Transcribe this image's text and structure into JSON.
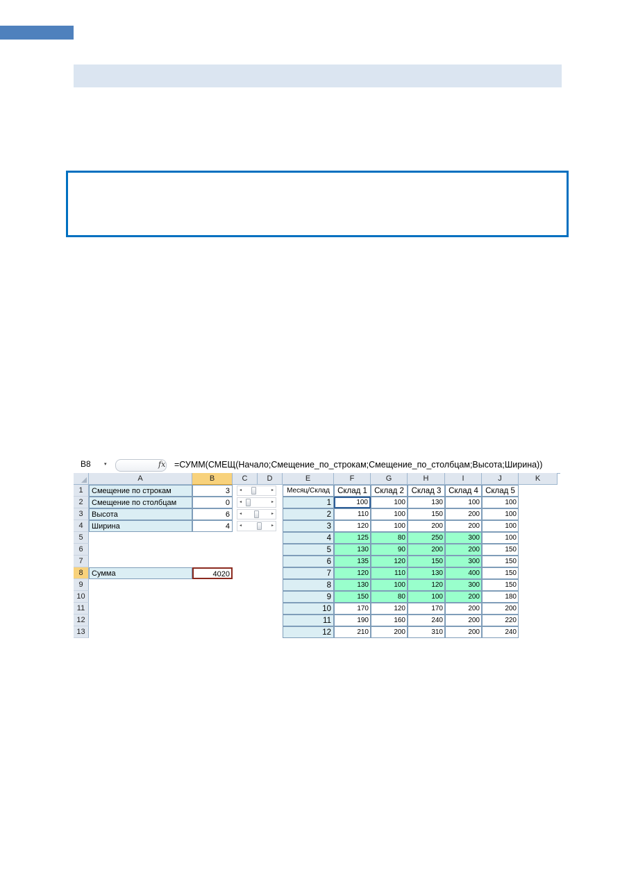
{
  "excel": {
    "name_box": "B8",
    "name_box_arrow": "▾",
    "fx_label": "fx",
    "formula": "=СУММ(СМЕЩ(Начало;Смещение_по_строкам;Смещение_по_столбцам;Высота;Ширина))",
    "columns": [
      "A",
      "B",
      "C",
      "D",
      "E",
      "F",
      "G",
      "H",
      "I",
      "J",
      "K"
    ],
    "rows": [
      "1",
      "2",
      "3",
      "4",
      "5",
      "6",
      "7",
      "8",
      "9",
      "10",
      "11",
      "12",
      "13"
    ],
    "parameters": [
      {
        "label": "Смещение по строкам",
        "value": "3",
        "slider": 0.3
      },
      {
        "label": "Смещение по столбцам",
        "value": "0",
        "slider": 0.0
      },
      {
        "label": "Высота",
        "value": "6",
        "slider": 0.45
      },
      {
        "label": "Ширина",
        "value": "4",
        "slider": 0.6
      }
    ],
    "sum": {
      "label": "Сумма",
      "value": "4020"
    },
    "table": {
      "corner_header": "Месяц/Склад",
      "headers": [
        "Склад 1",
        "Склад 2",
        "Склад 3",
        "Склад 4",
        "Склад 5"
      ],
      "rows": [
        {
          "month": "1",
          "values": [
            "100",
            "100",
            "130",
            "100",
            "100"
          ]
        },
        {
          "month": "2",
          "values": [
            "110",
            "100",
            "150",
            "200",
            "100"
          ]
        },
        {
          "month": "3",
          "values": [
            "120",
            "100",
            "200",
            "200",
            "100"
          ]
        },
        {
          "month": "4",
          "values": [
            "125",
            "80",
            "250",
            "300",
            "100"
          ]
        },
        {
          "month": "5",
          "values": [
            "130",
            "90",
            "200",
            "200",
            "150"
          ]
        },
        {
          "month": "6",
          "values": [
            "135",
            "120",
            "150",
            "300",
            "150"
          ]
        },
        {
          "month": "7",
          "values": [
            "120",
            "110",
            "130",
            "400",
            "150"
          ]
        },
        {
          "month": "8",
          "values": [
            "130",
            "100",
            "120",
            "300",
            "150"
          ]
        },
        {
          "month": "9",
          "values": [
            "150",
            "80",
            "100",
            "200",
            "180"
          ]
        },
        {
          "month": "10",
          "values": [
            "170",
            "120",
            "170",
            "200",
            "200"
          ]
        },
        {
          "month": "11",
          "values": [
            "190",
            "160",
            "240",
            "200",
            "220"
          ]
        },
        {
          "month": "12",
          "values": [
            "210",
            "200",
            "310",
            "200",
            "240"
          ]
        }
      ],
      "highlight_color": "#99ffcc"
    }
  }
}
